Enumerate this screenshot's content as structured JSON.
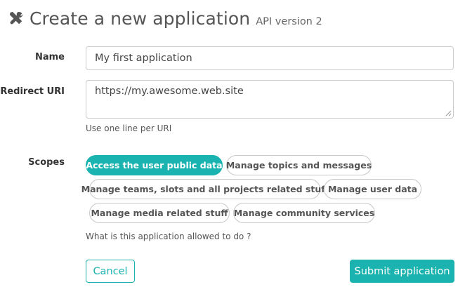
{
  "header": {
    "icon": "tools-icon",
    "title": "Create a new application",
    "subtitle": "API version 2"
  },
  "form": {
    "name": {
      "label": "Name",
      "value": "My first application"
    },
    "redirect_uri": {
      "label": "Redirect URI",
      "value": "https://my.awesome.web.site",
      "help": "Use one line per URI"
    },
    "scopes": {
      "label": "Scopes",
      "items": [
        {
          "label": "Access the user public data",
          "selected": true
        },
        {
          "label": "Manage topics and messages",
          "selected": false
        },
        {
          "label": "Manage teams, slots and all projects related stuff",
          "selected": false
        },
        {
          "label": "Manage user data",
          "selected": false
        },
        {
          "label": "Manage media related stuff",
          "selected": false
        },
        {
          "label": "Manage community services",
          "selected": false
        }
      ],
      "help": "What is this application allowed to do ?"
    },
    "cancel_label": "Cancel",
    "submit_label": "Submit application"
  },
  "colors": {
    "accent": "#1ab3b0",
    "text": "#333333",
    "border": "#cccccc"
  }
}
